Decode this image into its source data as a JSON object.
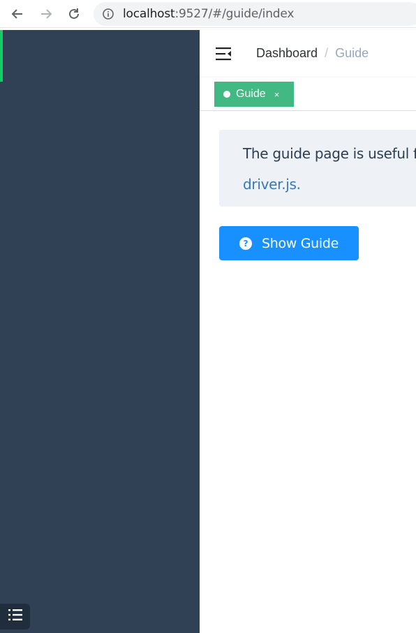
{
  "browser": {
    "url_host": "localhost",
    "url_rest": ":9527/#/guide/index",
    "icons": [
      "back-arrow-icon",
      "forward-arrow-icon",
      "reload-icon",
      "info-icon"
    ]
  },
  "colors": {
    "sidebar": "#304156",
    "tag_active": "#42b983",
    "primary_button": "#1890ff",
    "accent_green": "#13ce66"
  },
  "navbar": {
    "breadcrumb": [
      "Dashboard",
      "Guide"
    ],
    "separator": "/"
  },
  "tags": [
    {
      "label": "Guide",
      "close": "×",
      "active": true
    }
  ],
  "notice": {
    "text": "The guide page is useful f",
    "link": "driver.js."
  },
  "actions": {
    "show_guide_label": "Show Guide",
    "show_guide_icon": "?"
  }
}
